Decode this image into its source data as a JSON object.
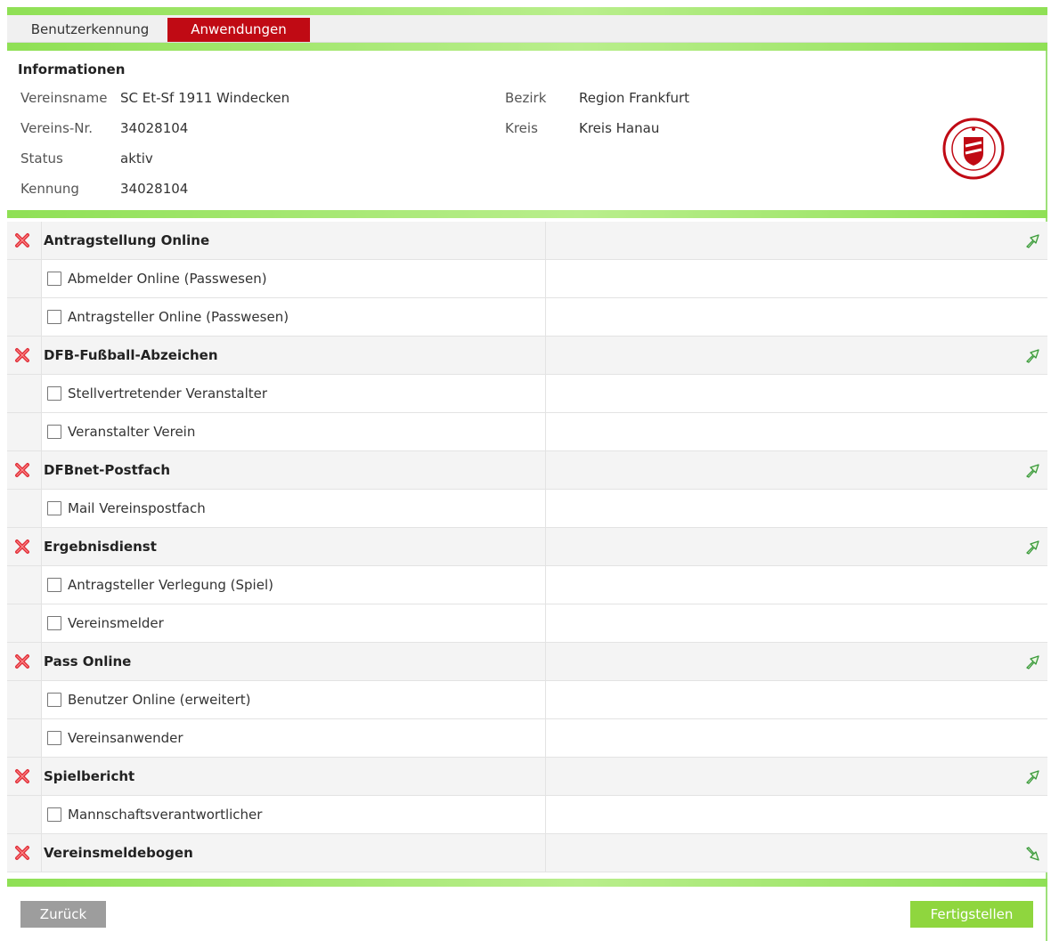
{
  "tabs": [
    {
      "label": "Benutzerkennung",
      "active": false
    },
    {
      "label": "Anwendungen",
      "active": true
    }
  ],
  "colors": {
    "accent": "#c00a14",
    "green": "#8fe055",
    "button_green": "#8fd63e",
    "button_grey": "#9d9d9d"
  },
  "info": {
    "title": "Informationen",
    "fields": {
      "vereinsname": {
        "label": "Vereinsname",
        "value": "SC Et-Sf 1911 Windecken"
      },
      "vereinsnr": {
        "label": "Vereins-Nr.",
        "value": "34028104"
      },
      "status": {
        "label": "Status",
        "value": "aktiv"
      },
      "kennung": {
        "label": "Kennung",
        "value": "34028104"
      },
      "bezirk": {
        "label": "Bezirk",
        "value": "Region Frankfurt"
      },
      "kreis": {
        "label": "Kreis",
        "value": "Kreis Hanau"
      }
    }
  },
  "applications": [
    {
      "group": "Antragstellung Online",
      "items": [
        "Abmelder Online (Passwesen)",
        "Antragsteller Online (Passwesen)"
      ],
      "arrow": "collapse"
    },
    {
      "group": "DFB-Fußball-Abzeichen",
      "items": [
        "Stellvertretender Veranstalter",
        "Veranstalter Verein"
      ],
      "arrow": "collapse"
    },
    {
      "group": "DFBnet-Postfach",
      "items": [
        "Mail Vereinspostfach"
      ],
      "arrow": "collapse"
    },
    {
      "group": "Ergebnisdienst",
      "items": [
        "Antragsteller Verlegung (Spiel)",
        "Vereinsmelder"
      ],
      "arrow": "collapse"
    },
    {
      "group": "Pass Online",
      "items": [
        "Benutzer Online (erweitert)",
        "Vereinsanwender"
      ],
      "arrow": "collapse"
    },
    {
      "group": "Spielbericht",
      "items": [
        "Mannschaftsverantwortlicher"
      ],
      "arrow": "collapse"
    },
    {
      "group": "Vereinsmeldebogen",
      "items": [],
      "arrow": "expand"
    }
  ],
  "buttons": {
    "back": "Zurück",
    "finish": "Fertigstellen"
  }
}
